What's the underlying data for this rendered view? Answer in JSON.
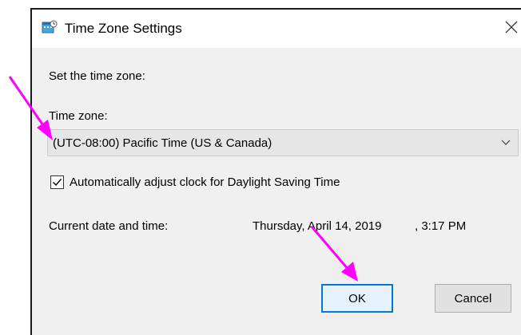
{
  "window": {
    "title": "Time Zone Settings",
    "close_glyph": "✕"
  },
  "content": {
    "instruction": "Set the time zone:",
    "timezone_label": "Time zone:",
    "timezone_value": "(UTC-08:00) Pacific Time (US & Canada)",
    "dst_checkbox_label": "Automatically adjust clock for Daylight Saving Time",
    "dst_checked": true,
    "current_datetime_label": "Current date and time:",
    "current_date": "Thursday, April 14, 2019",
    "current_time": ", 3:17 PM"
  },
  "buttons": {
    "ok_label": "OK",
    "cancel_label": "Cancel"
  },
  "colors": {
    "annotation_arrow": "#ff00ff",
    "focus_border": "#0078d7"
  }
}
